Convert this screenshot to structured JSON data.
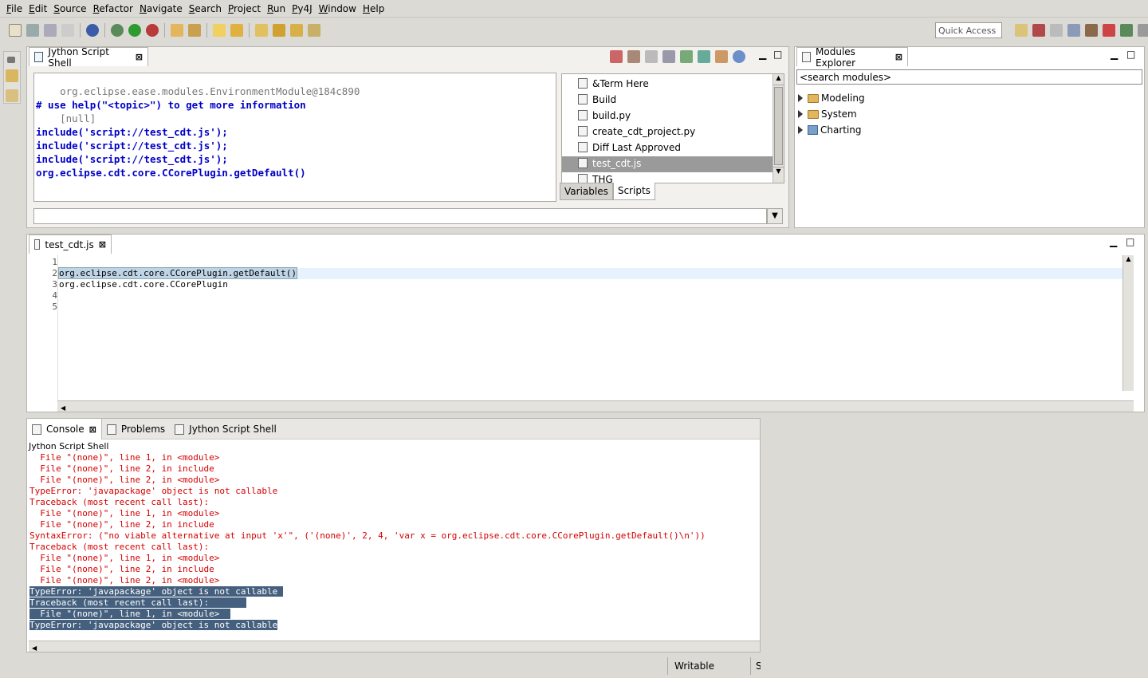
{
  "menu": [
    "File",
    "Edit",
    "Source",
    "Refactor",
    "Navigate",
    "Search",
    "Project",
    "Run",
    "Py4J",
    "Window",
    "Help"
  ],
  "quick_access": "Quick Access",
  "shell": {
    "tab_label": "Jython Script Shell",
    "lines": [
      {
        "text": "    org.eclipse.ease.modules.EnvironmentModule@184c890",
        "style": "gray"
      },
      {
        "text": "# use help(\"<topic>\") to get more information",
        "style": "blue"
      },
      {
        "text": "    [null]",
        "style": "gray"
      },
      {
        "text": "include('script://test_cdt.js');",
        "style": "blue"
      },
      {
        "text": "include('script://test_cdt.js');",
        "style": "blue"
      },
      {
        "text": "include('script://test_cdt.js');",
        "style": "blue"
      },
      {
        "text": "org.eclipse.cdt.core.CCorePlugin.getDefault()",
        "style": "blue"
      }
    ],
    "input_value": ""
  },
  "scripts": {
    "items": [
      "&Term Here",
      "Build",
      "build.py",
      "create_cdt_project.py",
      "Diff Last Approved",
      "test_cdt.js",
      "THG"
    ],
    "selected": "test_cdt.js",
    "tabs": [
      "Variables",
      "Scripts"
    ],
    "active_tab": "Scripts"
  },
  "modules": {
    "tab_label": "Modules Explorer",
    "search_placeholder": "<search modules>",
    "items": [
      "Modeling",
      "System",
      "Charting"
    ]
  },
  "editor": {
    "tab_label": "test_cdt.js",
    "line_numbers": [
      "1",
      "2",
      "3",
      "4",
      "5"
    ],
    "lines": [
      "",
      "org.eclipse.cdt.core.CCorePlugin.getDefault()",
      "org.eclipse.cdt.core.CCorePlugin",
      "",
      ""
    ]
  },
  "bottom": {
    "tabs": [
      "Console",
      "Problems",
      "Jython Script Shell"
    ],
    "console_title": "Jython Script Shell",
    "lines": [
      "  File \"(none)\", line 1, in <module>",
      "  File \"(none)\", line 2, in include",
      "  File \"(none)\", line 2, in <module>",
      "TypeError: 'javapackage' object is not callable",
      "Traceback (most recent call last):",
      "  File \"(none)\", line 1, in <module>",
      "  File \"(none)\", line 2, in include",
      "SyntaxError: (\"no viable alternative at input 'x'\", ('(none)', 2, 4, 'var x = org.eclipse.cdt.core.CCorePlugin.getDefault()\\n'))",
      "Traceback (most recent call last):",
      "  File \"(none)\", line 1, in <module>",
      "  File \"(none)\", line 2, in include",
      "  File \"(none)\", line 2, in <module>",
      "TypeError: 'javapackage' object is not callable ",
      "Traceback (most recent call last):       ",
      "  File \"(none)\", line 1, in <module>  ",
      "TypeError: 'javapackage' object is not callable"
    ],
    "selected_from": 12
  },
  "status": {
    "writable": "Writable",
    "extra": "S"
  }
}
